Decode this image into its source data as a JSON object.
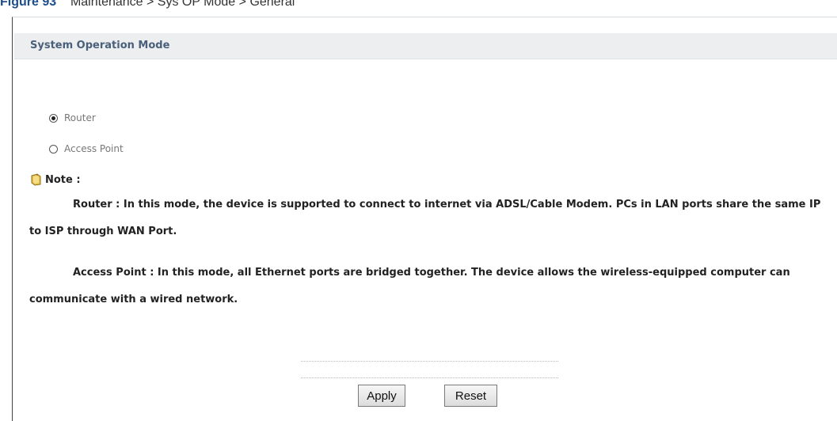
{
  "caption": {
    "label": "Figure 93",
    "text": "Maintenance > Sys OP Mode > General"
  },
  "section": {
    "title": "System Operation Mode"
  },
  "mode_options": [
    {
      "label": "Router",
      "selected": true
    },
    {
      "label": "Access Point",
      "selected": false
    }
  ],
  "note": {
    "icon": "note-icon",
    "title": "Note :",
    "router_text": "Router : In this mode, the device is supported to connect to internet via ADSL/Cable Modem. PCs in LAN ports share the same IP to ISP through WAN Port.",
    "ap_text": "Access Point : In this mode, all Ethernet ports are bridged together. The device allows the wireless-equipped computer can communicate with a wired network."
  },
  "buttons": {
    "apply": "Apply",
    "reset": "Reset"
  },
  "colors": {
    "header_bg": "#eceef0",
    "header_text": "#4a5f7a",
    "caption_label": "#1f4e8c"
  }
}
